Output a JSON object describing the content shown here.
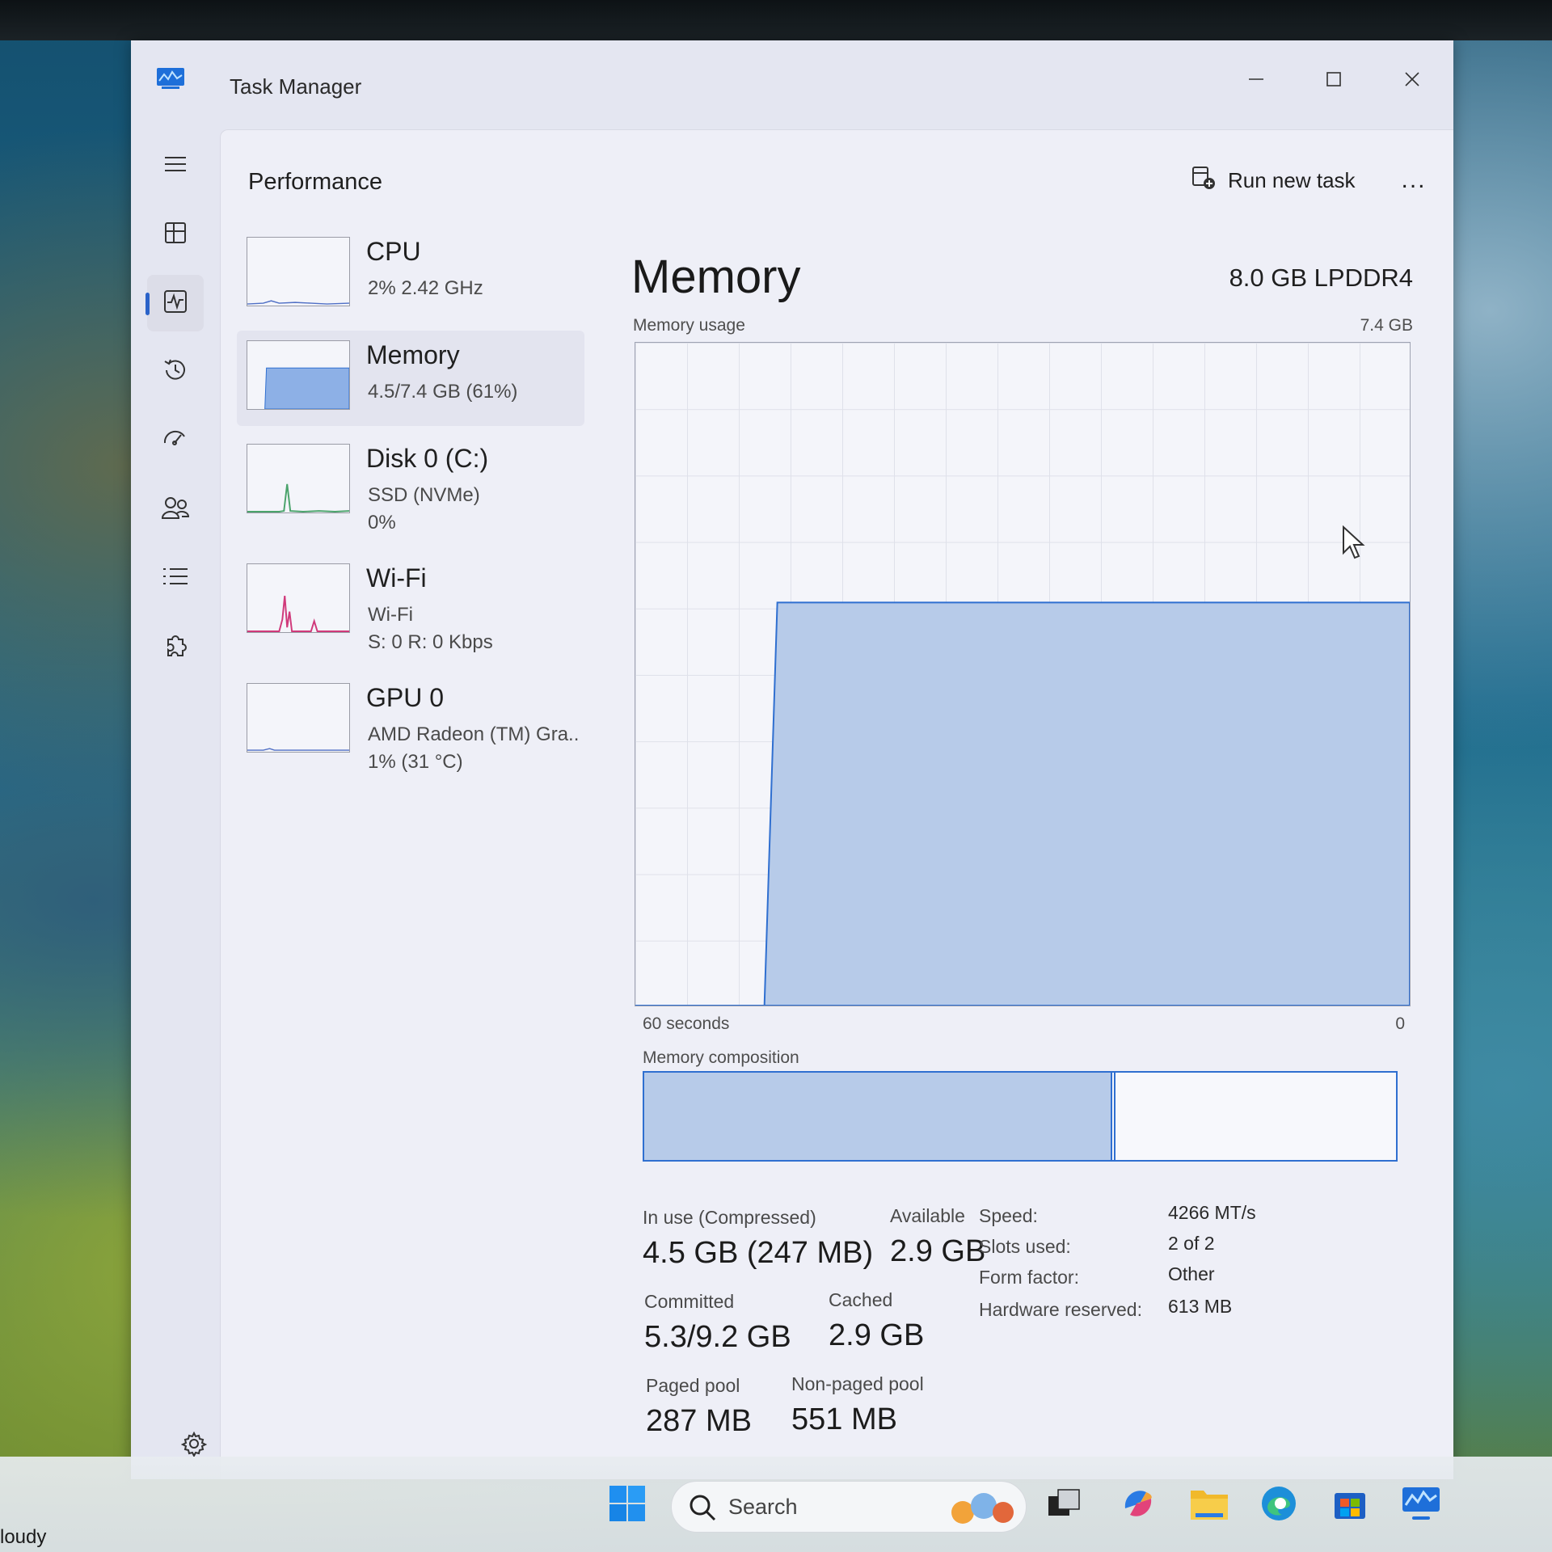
{
  "app": {
    "title": "Task Manager"
  },
  "window_controls": {
    "minimize": "minimize",
    "maximize": "maximize",
    "close": "close"
  },
  "header": {
    "page_title": "Performance",
    "run_new_task": "Run new task",
    "more": "..."
  },
  "nav": {
    "items": [
      {
        "id": "menu",
        "icon": "hamburger-icon"
      },
      {
        "id": "processes",
        "icon": "processes-grid-icon"
      },
      {
        "id": "performance",
        "icon": "performance-pulse-icon",
        "active": true
      },
      {
        "id": "app-history",
        "icon": "history-icon"
      },
      {
        "id": "startup-apps",
        "icon": "startup-gauge-icon"
      },
      {
        "id": "users",
        "icon": "users-icon"
      },
      {
        "id": "details",
        "icon": "list-icon"
      },
      {
        "id": "services",
        "icon": "puzzle-icon"
      }
    ],
    "settings_icon": "gear-icon"
  },
  "devices": [
    {
      "name": "CPU",
      "sub1": "2%  2.42 GHz",
      "sub2": ""
    },
    {
      "name": "Memory",
      "sub1": "4.5/7.4 GB (61%)",
      "sub2": "",
      "selected": true
    },
    {
      "name": "Disk 0 (C:)",
      "sub1": "SSD (NVMe)",
      "sub2": "0%"
    },
    {
      "name": "Wi-Fi",
      "sub1": "Wi-Fi",
      "sub2": "S: 0  R: 0 Kbps"
    },
    {
      "name": "GPU 0",
      "sub1": "AMD Radeon (TM) Gra..",
      "sub2": "1% (31 °C)"
    }
  ],
  "detail": {
    "title": "Memory",
    "spec": "8.0 GB LPDDR4",
    "usage_label": "Memory usage",
    "usage_max": "7.4 GB",
    "x_left": "60 seconds",
    "x_right": "0",
    "composition_label": "Memory composition",
    "composition_in_use_fraction": 0.62,
    "stats": {
      "in_use_label": "In use (Compressed)",
      "in_use_value": "4.5 GB (247 MB)",
      "available_label": "Available",
      "available_value": "2.9 GB",
      "committed_label": "Committed",
      "committed_value": "5.3/9.2 GB",
      "cached_label": "Cached",
      "cached_value": "2.9 GB",
      "paged_label": "Paged pool",
      "paged_value": "287 MB",
      "nonpaged_label": "Non-paged pool",
      "nonpaged_value": "551 MB"
    },
    "specs": [
      {
        "label": "Speed:",
        "value": "4266 MT/s"
      },
      {
        "label": "Slots used:",
        "value": "2 of 2"
      },
      {
        "label": "Form factor:",
        "value": "Other"
      },
      {
        "label": "Hardware reserved:",
        "value": "613 MB"
      }
    ]
  },
  "chart_data": {
    "type": "area",
    "ylabel": "Memory usage",
    "ylim": [
      0,
      7.4
    ],
    "xlim": [
      60,
      0
    ],
    "series": [
      {
        "x": [
          60,
          50,
          49,
          40,
          30,
          20,
          10,
          0
        ],
        "values": [
          0,
          0,
          4.5,
          4.5,
          4.5,
          4.5,
          4.5,
          4.5
        ]
      }
    ]
  },
  "taskbar": {
    "search_placeholder": "Search",
    "icons": [
      "windows-start-icon",
      "search-icon",
      "task-view-icon",
      "copilot-icon",
      "file-explorer-icon",
      "edge-icon",
      "store-icon",
      "task-manager-icon"
    ]
  },
  "weather": {
    "text": "loudy"
  },
  "colors": {
    "accent": "#2f6fd0",
    "memory_fill": "#b7cbe9",
    "wifi_line": "#d0397a",
    "disk_line": "#4aa36b"
  }
}
